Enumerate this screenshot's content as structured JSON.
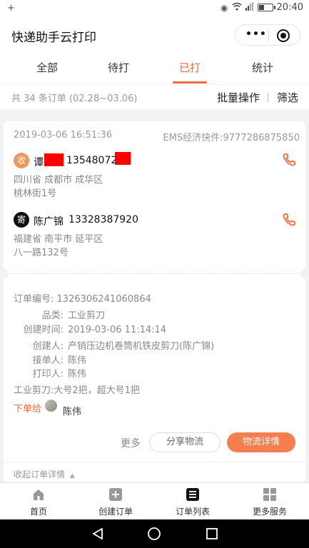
{
  "status_bar": {
    "left_text": "+",
    "time": "20:40",
    "battery_level": 0.35
  },
  "header": {
    "title": "快递助手云打印"
  },
  "tabs": [
    {
      "label": "全部",
      "active": false
    },
    {
      "label": "待打",
      "active": false
    },
    {
      "label": "已打",
      "active": true
    },
    {
      "label": "统计",
      "active": false
    }
  ],
  "summary": {
    "count_text": "共 34 条订单 (02.28~03.06)",
    "bulk_label": "批量操作",
    "filter_label": "筛选"
  },
  "order": {
    "datetime": "2019-03-06 16:51:36",
    "ems_text": "EMS经济快件:9777286875850",
    "recipient": {
      "badge": "收",
      "name_visible": "谭",
      "phone_visible": "13548072",
      "address_line1": "四川省 成都市 成华区",
      "address_line2": "桃林街1号"
    },
    "sender": {
      "badge": "寄",
      "name": "陈广锦",
      "phone": "13328387920",
      "address_line1": "福建省 南平市 延平区",
      "address_line2": "八一路132号"
    },
    "details": {
      "order_no_label": "订单编号:",
      "order_no": "1326306241060864",
      "category_label": "品类:",
      "category": "工业剪刀",
      "created_time_label": "创建时间:",
      "created_time": "2019-03-06 11:14:14",
      "creator_label": "创建人:",
      "creator": "产销压边机卷筒机铁皮剪刀(陈广锦)",
      "receiver_label": "接单人:",
      "receiver": "陈伟",
      "printer_label": "打印人:",
      "printer": "陈伟",
      "items": "工业剪刀:大号2把，超大号1把"
    },
    "assign_label": "下单给",
    "assignee": "陈伟",
    "more_label": "更多",
    "share_label": "分享物流",
    "detail_label": "物流详情",
    "collapse_label": "收起订单详情"
  },
  "bottom_nav": [
    {
      "label": "首页",
      "icon": "home-icon"
    },
    {
      "label": "创建订单",
      "icon": "add-order-icon"
    },
    {
      "label": "订单列表",
      "icon": "order-list-icon"
    },
    {
      "label": "更多服务",
      "icon": "grid-icon"
    }
  ],
  "colors": {
    "accent": "#f26b3a",
    "button": "#f47e4e",
    "recv_badge": "#f1975b",
    "send_badge": "#111111",
    "redaction": "#ff0000"
  }
}
